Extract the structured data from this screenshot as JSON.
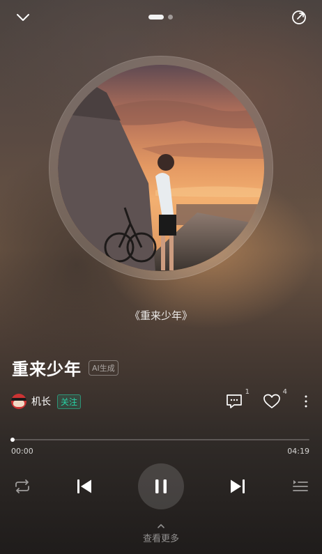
{
  "header": {
    "collapse_icon": "chevron-down-icon",
    "share_icon": "share-icon",
    "pager": {
      "pages": 2,
      "active": 1
    }
  },
  "artwork": {
    "caption": "《重来少年》"
  },
  "song": {
    "title": "重来少年",
    "ai_tag": "AI生成"
  },
  "artist": {
    "name": "机长",
    "follow_label": "关注"
  },
  "actions": {
    "comment_count": "1",
    "like_count": "4"
  },
  "player": {
    "current_time": "00:00",
    "duration": "04:19",
    "progress": 0.0
  },
  "controls": {
    "repeat_icon": "repeat-icon",
    "prev_icon": "previous-icon",
    "pause_icon": "pause-icon",
    "next_icon": "next-icon",
    "queue_icon": "playlist-icon"
  },
  "footer": {
    "more_label": "查看更多"
  },
  "colors": {
    "accent": "#27d3a5"
  }
}
